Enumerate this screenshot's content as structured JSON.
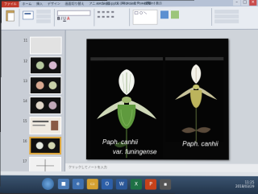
{
  "window": {
    "file_tab": "ファイル",
    "title": "orchid展.pptx - Microsoft PowerPoint",
    "ribbon_tabs": [
      "ホーム",
      "挿入",
      "デザイン",
      "画面切り替え",
      "アニメーション",
      "スライド ショー",
      "校閲",
      "表示"
    ]
  },
  "ribbon": {
    "groups": [
      {
        "label": "貼り付け"
      },
      {
        "label": "新しいスライド"
      },
      {
        "label": "フォント"
      },
      {
        "label": "段落"
      },
      {
        "label": "図形描画"
      },
      {
        "label": "編集"
      }
    ]
  },
  "thumbnails": {
    "numbers": [
      "11",
      "12",
      "13",
      "14",
      "15",
      "16",
      "17"
    ]
  },
  "slide": {
    "label_left_line1": "Paph. canhii",
    "label_left_line2": "var. funingense",
    "label_right": "Paph. canhii"
  },
  "notes": {
    "placeholder": "クリックしてノートを入力"
  },
  "tray": {
    "time": "11:25",
    "date": "2018/03/29"
  },
  "colors": {
    "slide_background": "#070707",
    "label_color": "#ffffff",
    "selected_thumb_border": "#e2a93b",
    "file_tab": "#c0392b"
  }
}
